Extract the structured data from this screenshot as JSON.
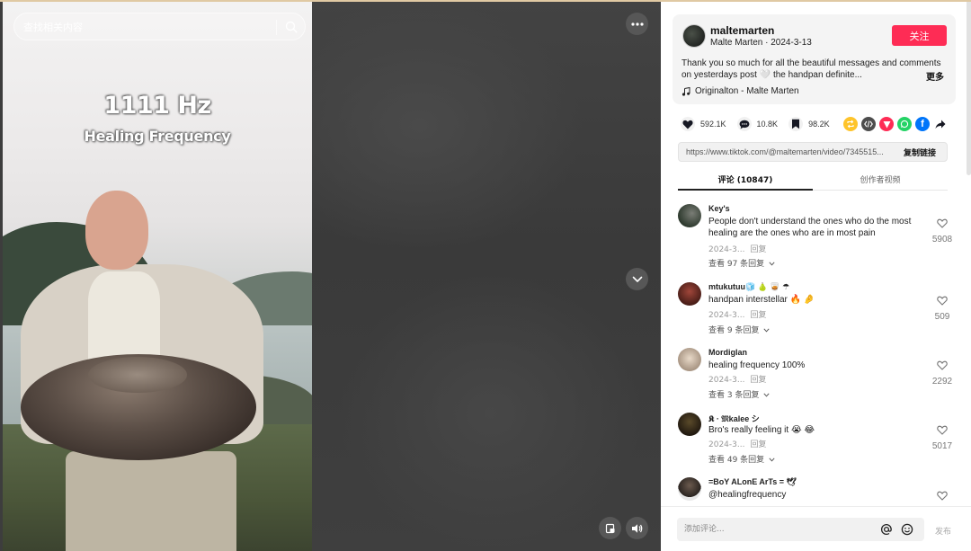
{
  "search": {
    "placeholder": "查找相关内容"
  },
  "video": {
    "overlay_title": "1111 Hz",
    "overlay_subtitle": "Healing Frequency"
  },
  "author": {
    "username": "maltemarten",
    "meta": "Malte Marten · 2024-3-13",
    "follow_label": "关注",
    "description": "Thank you so much for all the beautiful messages and comments on yesterdays post 🤍 the handpan definite...",
    "more_label": "更多",
    "music": "Originalton - Malte Marten"
  },
  "stats": {
    "likes": "592.1K",
    "comments": "10.8K",
    "saves": "98.2K"
  },
  "share_icons": [
    "repost-icon",
    "embed-icon",
    "send-icon",
    "whatsapp-icon",
    "facebook-icon",
    "share-arrow-icon"
  ],
  "colors": {
    "accent": "#fe2c55",
    "panel_bg": "#ffffff",
    "video_bg": "#3d3d3d"
  },
  "link": {
    "url": "https://www.tiktok.com/@maltemarten/video/7345515...",
    "copy_label": "复制链接"
  },
  "tabs": {
    "comments": "评论 (10847)",
    "creator_videos": "创作者视频"
  },
  "comments": [
    {
      "user": "Key's",
      "text": "People don't understand the ones who do the most healing are the ones who are in most pain",
      "date": "2024-3...",
      "reply_label": "回复",
      "view_replies": "查看 97 条回复",
      "likes": "5908"
    },
    {
      "user": "mtukutuu🧊 🍐 🥃 ☂",
      "text": "handpan interstellar 🔥 🤌",
      "date": "2024-3...",
      "reply_label": "回复",
      "view_replies": "查看 9 条回复",
      "likes": "509"
    },
    {
      "user": "Mordiglan",
      "text": "healing frequency 100%",
      "date": "2024-3...",
      "reply_label": "回复",
      "view_replies": "查看 3 条回复",
      "likes": "2292"
    },
    {
      "user": "𝕶 · 𝔐kalee シ",
      "text": "Bro's really feeling it 😭 😂",
      "date": "2024-3...",
      "reply_label": "回复",
      "view_replies": "查看 49 条回复",
      "likes": "5017"
    },
    {
      "user": "=BoY ALonE ArTs = 🕊",
      "text": "@healingfrequency",
      "date": "",
      "reply_label": "",
      "view_replies": "",
      "likes": ""
    }
  ],
  "comment_input": {
    "placeholder": "添加评论...",
    "post_label": "发布"
  }
}
